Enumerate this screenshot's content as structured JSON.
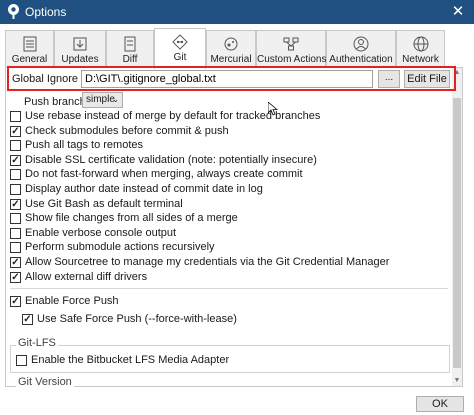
{
  "window": {
    "title": "Options",
    "close_glyph": "✕",
    "titlebar_color": "#205081"
  },
  "tabs": [
    {
      "label": "General",
      "icon": "general-icon"
    },
    {
      "label": "Updates",
      "icon": "updates-icon"
    },
    {
      "label": "Diff",
      "icon": "diff-icon"
    },
    {
      "label": "Git",
      "icon": "git-icon",
      "active": true
    },
    {
      "label": "Mercurial",
      "icon": "mercurial-icon"
    },
    {
      "label": "Custom Actions",
      "icon": "custom-actions-icon"
    },
    {
      "label": "Authentication",
      "icon": "authentication-icon"
    },
    {
      "label": "Network",
      "icon": "network-icon"
    }
  ],
  "git": {
    "ignore_label": "Global Ignore List:",
    "ignore_value": "D:\\GIT\\.gitignore_global.txt",
    "browse_label": "...",
    "edit_label": "Edit File",
    "push_label": "Push branches:",
    "push_value": "simple",
    "options": [
      {
        "label": "Use rebase instead of merge by default for tracked branches",
        "checked": false
      },
      {
        "label": "Check submodules before commit & push",
        "checked": true
      },
      {
        "label": "Push all tags to remotes",
        "checked": false
      },
      {
        "label": "Disable SSL certificate validation (note: potentially insecure)",
        "checked": true
      },
      {
        "label": "Do not fast-forward when merging, always create commit",
        "checked": false
      },
      {
        "label": "Display author date instead of commit date in log",
        "checked": false
      },
      {
        "label": "Use Git Bash as default terminal",
        "checked": true
      },
      {
        "label": "Show file changes from all sides of a merge",
        "checked": false
      },
      {
        "label": "Enable verbose console output",
        "checked": false
      },
      {
        "label": "Perform submodule actions recursively",
        "checked": false
      },
      {
        "label": "Allow Sourcetree to manage my credentials via the Git Credential Manager",
        "checked": true
      },
      {
        "label": "Allow external diff drivers",
        "checked": true
      }
    ],
    "force_push": {
      "label": "Enable Force Push",
      "checked": true
    },
    "safe_force_push": {
      "label": "Use Safe Force Push (--force-with-lease)",
      "checked": true
    },
    "lfs_title": "Git-LFS",
    "lfs_option": {
      "label": "Enable the Bitbucket LFS Media Adapter",
      "checked": false
    },
    "version_title": "Git Version"
  },
  "footer": {
    "ok_label": "OK"
  },
  "colors": {
    "highlight": "#e02424"
  }
}
